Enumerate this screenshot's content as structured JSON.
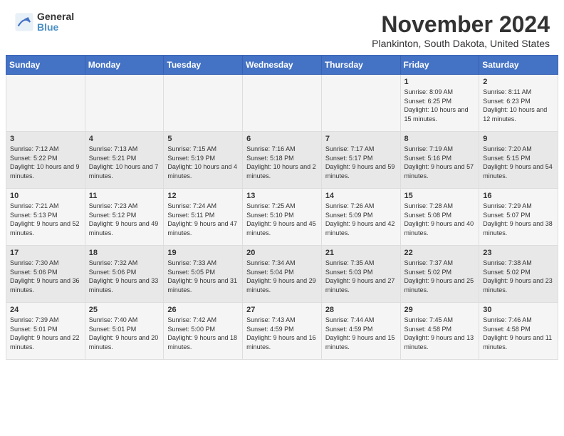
{
  "logo": {
    "general": "General",
    "blue": "Blue"
  },
  "title": "November 2024",
  "location": "Plankinton, South Dakota, United States",
  "days_of_week": [
    "Sunday",
    "Monday",
    "Tuesday",
    "Wednesday",
    "Thursday",
    "Friday",
    "Saturday"
  ],
  "weeks": [
    [
      {
        "day": "",
        "info": ""
      },
      {
        "day": "",
        "info": ""
      },
      {
        "day": "",
        "info": ""
      },
      {
        "day": "",
        "info": ""
      },
      {
        "day": "",
        "info": ""
      },
      {
        "day": "1",
        "info": "Sunrise: 8:09 AM\nSunset: 6:25 PM\nDaylight: 10 hours and 15 minutes."
      },
      {
        "day": "2",
        "info": "Sunrise: 8:11 AM\nSunset: 6:23 PM\nDaylight: 10 hours and 12 minutes."
      }
    ],
    [
      {
        "day": "3",
        "info": "Sunrise: 7:12 AM\nSunset: 5:22 PM\nDaylight: 10 hours and 9 minutes."
      },
      {
        "day": "4",
        "info": "Sunrise: 7:13 AM\nSunset: 5:21 PM\nDaylight: 10 hours and 7 minutes."
      },
      {
        "day": "5",
        "info": "Sunrise: 7:15 AM\nSunset: 5:19 PM\nDaylight: 10 hours and 4 minutes."
      },
      {
        "day": "6",
        "info": "Sunrise: 7:16 AM\nSunset: 5:18 PM\nDaylight: 10 hours and 2 minutes."
      },
      {
        "day": "7",
        "info": "Sunrise: 7:17 AM\nSunset: 5:17 PM\nDaylight: 9 hours and 59 minutes."
      },
      {
        "day": "8",
        "info": "Sunrise: 7:19 AM\nSunset: 5:16 PM\nDaylight: 9 hours and 57 minutes."
      },
      {
        "day": "9",
        "info": "Sunrise: 7:20 AM\nSunset: 5:15 PM\nDaylight: 9 hours and 54 minutes."
      }
    ],
    [
      {
        "day": "10",
        "info": "Sunrise: 7:21 AM\nSunset: 5:13 PM\nDaylight: 9 hours and 52 minutes."
      },
      {
        "day": "11",
        "info": "Sunrise: 7:23 AM\nSunset: 5:12 PM\nDaylight: 9 hours and 49 minutes."
      },
      {
        "day": "12",
        "info": "Sunrise: 7:24 AM\nSunset: 5:11 PM\nDaylight: 9 hours and 47 minutes."
      },
      {
        "day": "13",
        "info": "Sunrise: 7:25 AM\nSunset: 5:10 PM\nDaylight: 9 hours and 45 minutes."
      },
      {
        "day": "14",
        "info": "Sunrise: 7:26 AM\nSunset: 5:09 PM\nDaylight: 9 hours and 42 minutes."
      },
      {
        "day": "15",
        "info": "Sunrise: 7:28 AM\nSunset: 5:08 PM\nDaylight: 9 hours and 40 minutes."
      },
      {
        "day": "16",
        "info": "Sunrise: 7:29 AM\nSunset: 5:07 PM\nDaylight: 9 hours and 38 minutes."
      }
    ],
    [
      {
        "day": "17",
        "info": "Sunrise: 7:30 AM\nSunset: 5:06 PM\nDaylight: 9 hours and 36 minutes."
      },
      {
        "day": "18",
        "info": "Sunrise: 7:32 AM\nSunset: 5:06 PM\nDaylight: 9 hours and 33 minutes."
      },
      {
        "day": "19",
        "info": "Sunrise: 7:33 AM\nSunset: 5:05 PM\nDaylight: 9 hours and 31 minutes."
      },
      {
        "day": "20",
        "info": "Sunrise: 7:34 AM\nSunset: 5:04 PM\nDaylight: 9 hours and 29 minutes."
      },
      {
        "day": "21",
        "info": "Sunrise: 7:35 AM\nSunset: 5:03 PM\nDaylight: 9 hours and 27 minutes."
      },
      {
        "day": "22",
        "info": "Sunrise: 7:37 AM\nSunset: 5:02 PM\nDaylight: 9 hours and 25 minutes."
      },
      {
        "day": "23",
        "info": "Sunrise: 7:38 AM\nSunset: 5:02 PM\nDaylight: 9 hours and 23 minutes."
      }
    ],
    [
      {
        "day": "24",
        "info": "Sunrise: 7:39 AM\nSunset: 5:01 PM\nDaylight: 9 hours and 22 minutes."
      },
      {
        "day": "25",
        "info": "Sunrise: 7:40 AM\nSunset: 5:01 PM\nDaylight: 9 hours and 20 minutes."
      },
      {
        "day": "26",
        "info": "Sunrise: 7:42 AM\nSunset: 5:00 PM\nDaylight: 9 hours and 18 minutes."
      },
      {
        "day": "27",
        "info": "Sunrise: 7:43 AM\nSunset: 4:59 PM\nDaylight: 9 hours and 16 minutes."
      },
      {
        "day": "28",
        "info": "Sunrise: 7:44 AM\nSunset: 4:59 PM\nDaylight: 9 hours and 15 minutes."
      },
      {
        "day": "29",
        "info": "Sunrise: 7:45 AM\nSunset: 4:58 PM\nDaylight: 9 hours and 13 minutes."
      },
      {
        "day": "30",
        "info": "Sunrise: 7:46 AM\nSunset: 4:58 PM\nDaylight: 9 hours and 11 minutes."
      }
    ]
  ]
}
